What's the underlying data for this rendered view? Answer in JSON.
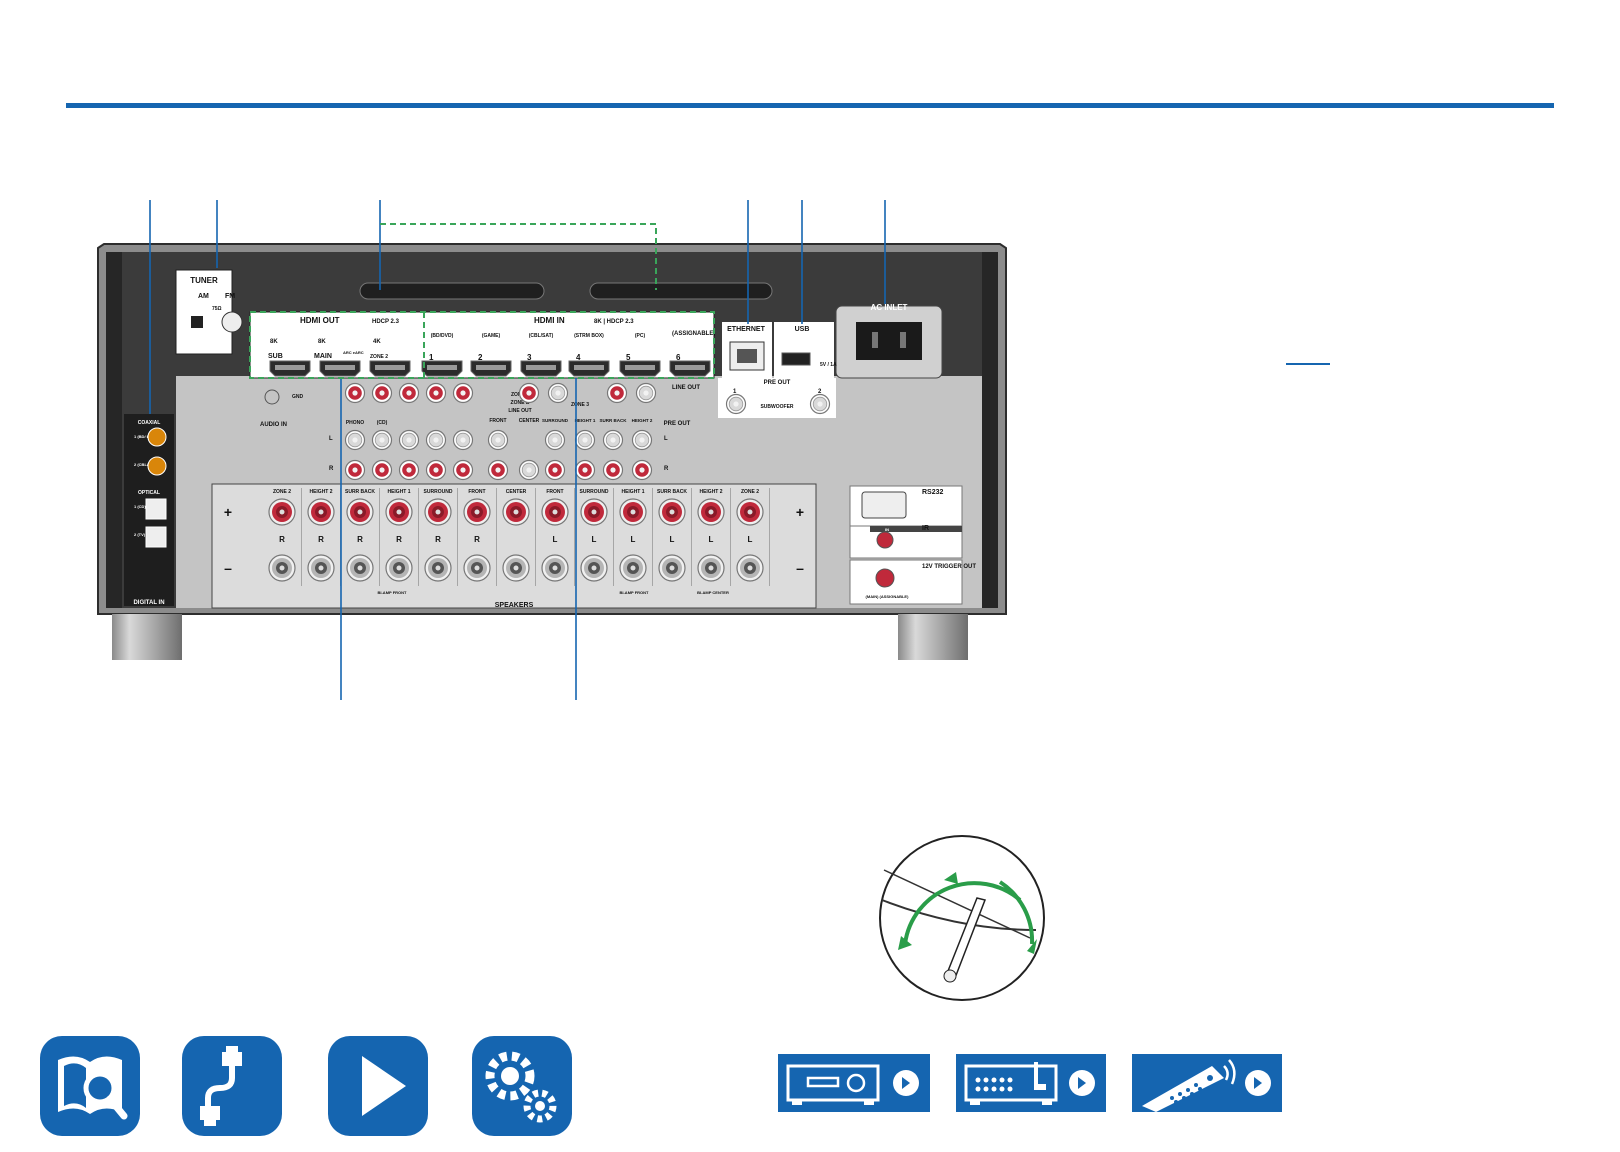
{
  "colors": {
    "accent": "#1565b0",
    "panel": "#3a3a3a",
    "callout_dashed": "#3aa55a",
    "speaker_red": "#c0293b",
    "arrow_green": "#2a9d49"
  },
  "panel_labels": {
    "tuner": "TUNER",
    "am": "AM",
    "fm": "FM",
    "ohm": "75Ω",
    "hdmi_out": "HDMI OUT",
    "hdcp_out": "HDCP 2.3",
    "hdmi_in": "HDMI IN",
    "hdcp_in": "8K | HDCP 2.3",
    "assignable": "(ASSIGNABLE)",
    "badge_8k": "8K",
    "badge_4k": "4K",
    "sub": "SUB",
    "main": "MAIN",
    "arc": "ARC eARC",
    "zone2": "ZONE 2",
    "in_bd": "(BD/DVD)",
    "in_game": "(GAME)",
    "in_cbl": "(CBL/SAT)",
    "in_strm": "(STRM BOX)",
    "in_pc": "(PC)",
    "in_1": "1",
    "in_2": "2",
    "in_3": "3",
    "in_4": "4",
    "in_5": "5",
    "in_6": "6",
    "ethernet": "ETHERNET",
    "usb": "USB",
    "usb_power": "5V / 1A",
    "ac_inlet": "AC INLET",
    "pre_out": "PRE OUT",
    "subwoofer": "SUBWOOFER",
    "sw1": "1",
    "sw2": "2",
    "line_out": "LINE OUT",
    "coaxial": "COAXIAL",
    "coax1": "1 (BD/ DVD)",
    "coax2": "2 (CBL/ SAT)",
    "optical": "OPTICAL",
    "opt1": "1 (CD)",
    "opt2": "2 (TV)",
    "digital_in": "DIGITAL IN",
    "audio_in": "AUDIO IN",
    "gnd": "GND",
    "phono": "PHONO",
    "cd": "(CD)",
    "zone2_b": "ZONE 2",
    "zone_b": "ZONE B",
    "zone_b_lineout": "LINE OUT",
    "zone3": "ZONE 3",
    "r": "R",
    "l": "L",
    "front": "FRONT",
    "center": "CENTER",
    "surround": "SURROUND",
    "height1": "HEIGHT 1",
    "surrback": "SURR BACK",
    "height2": "HEIGHT 2",
    "rs232": "RS232",
    "ir": "IR",
    "ir_in": "IN",
    "trigger": "12V TRIGGER OUT",
    "trigger_main": "(MAIN) (ASSIGNABLE)",
    "speakers": "SPEAKERS",
    "biamp_front": "BI-AMP FRONT",
    "biamp_center": "BI-AMP CENTER",
    "plus": "+",
    "minus": "–"
  },
  "speaker_terminals": [
    "ZONE 2",
    "HEIGHT 2",
    "SURR BACK",
    "HEIGHT 1",
    "SURROUND",
    "FRONT",
    "CENTER",
    "FRONT",
    "SURROUND",
    "HEIGHT 1",
    "SURR BACK",
    "HEIGHT 2",
    "ZONE 2"
  ],
  "speaker_channels": [
    "R",
    "R",
    "R",
    "R",
    "R",
    "R",
    "",
    "L",
    "L",
    "L",
    "L",
    "L",
    "L"
  ],
  "nav": {
    "left": [
      {
        "icon": "manual-search-icon"
      },
      {
        "icon": "connection-cable-icon"
      },
      {
        "icon": "playback-icon"
      },
      {
        "icon": "settings-gears-icon"
      }
    ],
    "right": [
      {
        "icon": "front-panel-icon"
      },
      {
        "icon": "rear-panel-icon"
      },
      {
        "icon": "remote-controller-icon"
      }
    ]
  }
}
